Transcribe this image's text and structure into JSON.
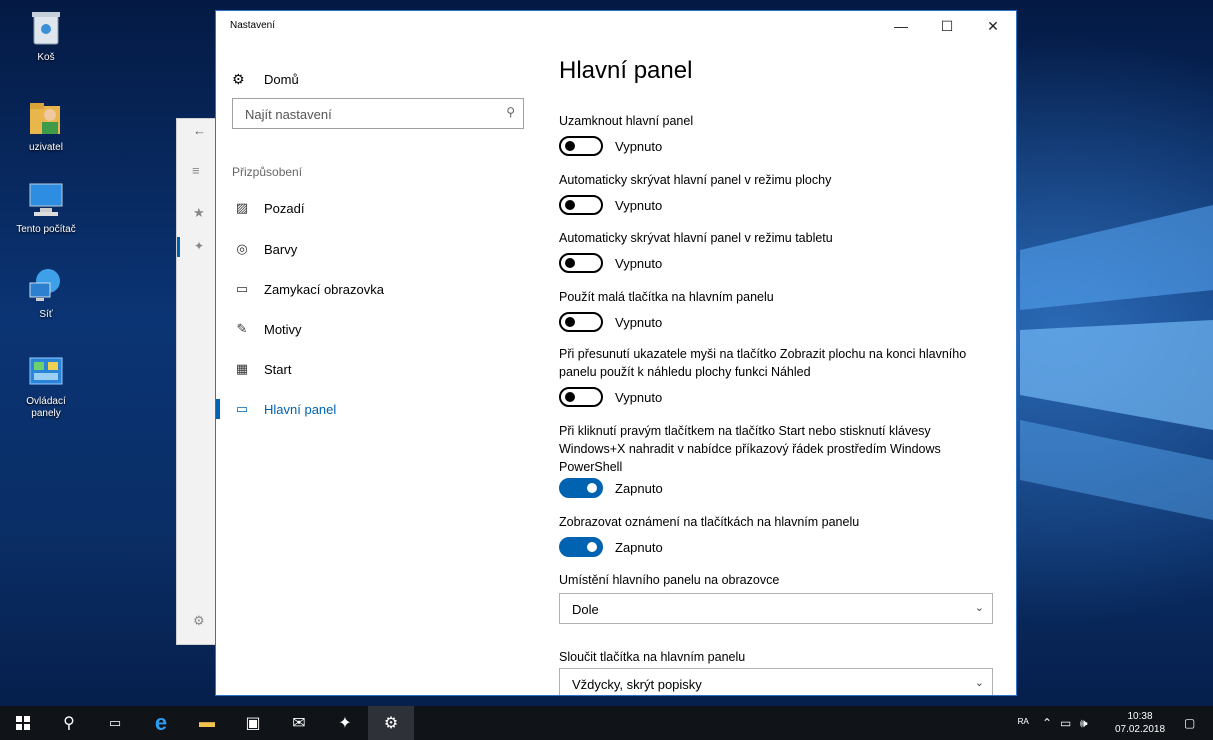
{
  "desktop": {
    "icons": [
      {
        "label": "Koš",
        "icon": "recycle-bin-icon"
      },
      {
        "label": "uzivatel",
        "icon": "user-folder-icon"
      },
      {
        "label": "Tento počítač",
        "icon": "computer-icon"
      },
      {
        "label": "Síť",
        "icon": "network-icon"
      },
      {
        "label": "Ovládací panely",
        "icon": "control-panel-icon"
      }
    ]
  },
  "window": {
    "title": "Nastavení",
    "controls": {
      "minimize": "—",
      "maximize": "☐",
      "close": "✕"
    }
  },
  "nav": {
    "home_label": "Domů",
    "search_placeholder": "Najít nastavení",
    "section_label": "Přizpůsobení",
    "items": [
      {
        "label": "Pozadí",
        "icon": "background-icon",
        "glyph": "▨"
      },
      {
        "label": "Barvy",
        "icon": "palette-icon",
        "glyph": "◎"
      },
      {
        "label": "Zamykací obrazovka",
        "icon": "lock-screen-icon",
        "glyph": "▭"
      },
      {
        "label": "Motivy",
        "icon": "themes-icon",
        "glyph": "✎"
      },
      {
        "label": "Start",
        "icon": "start-icon",
        "glyph": "▦"
      },
      {
        "label": "Hlavní panel",
        "icon": "taskbar-icon",
        "glyph": "▭",
        "active": true
      }
    ]
  },
  "content": {
    "heading": "Hlavní panel",
    "settings": [
      {
        "label": "Uzamknout hlavní panel",
        "state_text": "Vypnuto",
        "on": false
      },
      {
        "label": "Automaticky skrývat hlavní panel v režimu plochy",
        "state_text": "Vypnuto",
        "on": false
      },
      {
        "label": "Automaticky skrývat hlavní panel v režimu tabletu",
        "state_text": "Vypnuto",
        "on": false
      },
      {
        "label": "Použít malá tlačítka na hlavním panelu",
        "state_text": "Vypnuto",
        "on": false
      },
      {
        "label": "Při přesunutí ukazatele myši na tlačítko Zobrazit plochu na konci hlavního panelu použít k náhledu plochy funkci Náhled",
        "state_text": "Vypnuto",
        "on": false
      },
      {
        "label": "Při kliknutí pravým tlačítkem na tlačítko Start nebo stisknutí klávesy Windows+X nahradit v nabídce příkazový řádek prostředím Windows PowerShell",
        "state_text": "Zapnuto",
        "on": true
      },
      {
        "label": "Zobrazovat oznámení na tlačítkách na hlavním panelu",
        "state_text": "Zapnuto",
        "on": true
      }
    ],
    "position": {
      "label": "Umístění hlavního panelu na obrazovce",
      "value": "Dole"
    },
    "combine": {
      "label": "Sloučit tlačítka na hlavním panelu",
      "value": "Vždycky, skrýt popisky"
    }
  },
  "taskbar": {
    "tray_user": "ᴿᴬ",
    "time": "10:38",
    "date": "07.02.2018",
    "colors": {
      "accent": "#0063b1",
      "taskbar": "#101318"
    }
  }
}
